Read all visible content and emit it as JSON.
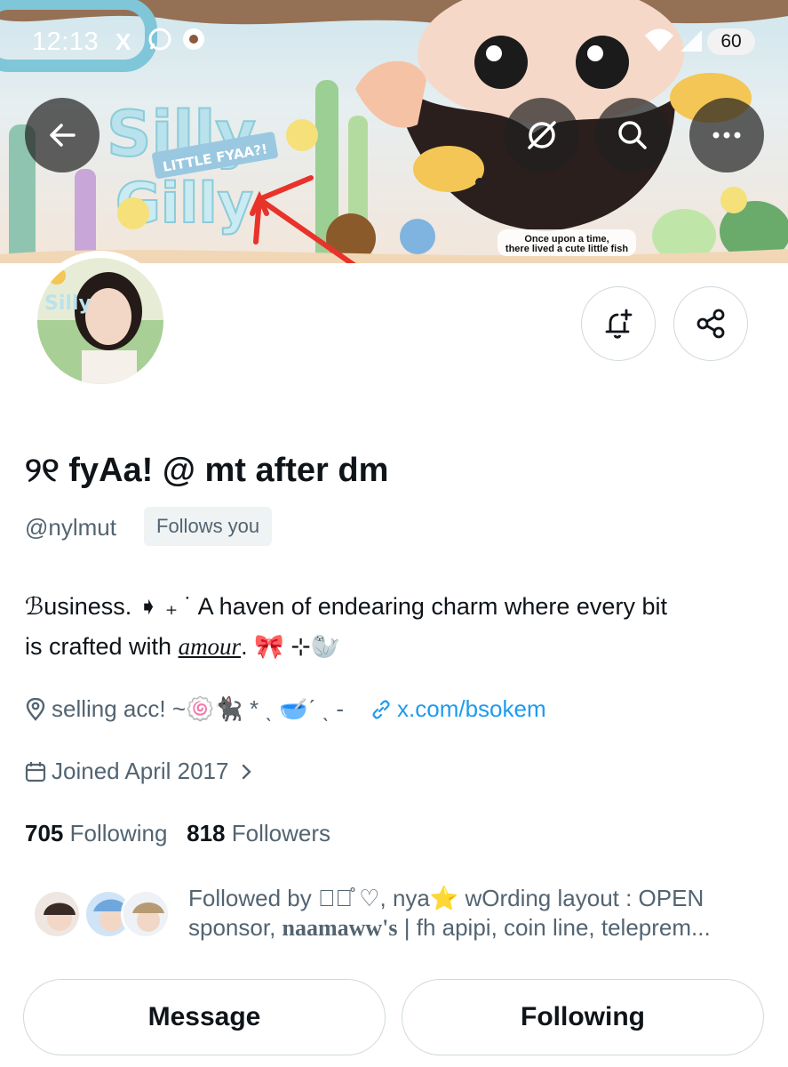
{
  "status_bar": {
    "time": "12:13",
    "x_icon": "X",
    "whatsapp_icon": "whatsapp-icon",
    "other_icon": "app-icon",
    "battery": "60"
  },
  "header": {
    "back_icon": "arrow-left-icon",
    "grok_icon": "slash-circle-icon",
    "search_icon": "search-icon",
    "more_icon": "more-icon"
  },
  "banner": {
    "text_main": "Silly Gilly",
    "text_ribbon": "LITTLE FYAA?!",
    "caption_line1": "Once upon a time,",
    "caption_line2": "there lived a cute little fish"
  },
  "profile": {
    "display_name": "୨୧ fyAa! @ mt after dm",
    "handle": "@nylmut",
    "follows_you": "Follows you",
    "bio_line1": "ℬusiness. ➧ ₊ ˙   A haven of endearing charm where every bit",
    "bio_line2_prefix": "is crafted with ",
    "bio_line2_emph": "amour",
    "bio_line2_suffix": ". 🎀 ⊹🦭",
    "location": "selling acc! ~🍥🐈‍⬛ * ˎ 🥣ˊ ˎ -",
    "website": "x.com/bsokem",
    "joined": "Joined April 2017",
    "following_count": "705",
    "following_label": "Following",
    "followers_count": "818",
    "followers_label": "Followers",
    "followed_by_line1": "Followed by ᷼⌒̊ ♡, nya⭐ wOrding layout : OPEN",
    "followed_by_line2_prefix": "sponsor, ",
    "followed_by_line2_bold": "naamaww's",
    "followed_by_line2_suffix": " | fh apipi, coin line, teleprem..."
  },
  "actions": {
    "notify_icon": "bell-plus-icon",
    "share_icon": "share-icon",
    "message": "Message",
    "following": "Following"
  },
  "colors": {
    "text_primary": "#0f1419",
    "text_secondary": "#536471",
    "link": "#1d9bf0",
    "border": "#cfd9de",
    "annotation": "#e8332b"
  }
}
